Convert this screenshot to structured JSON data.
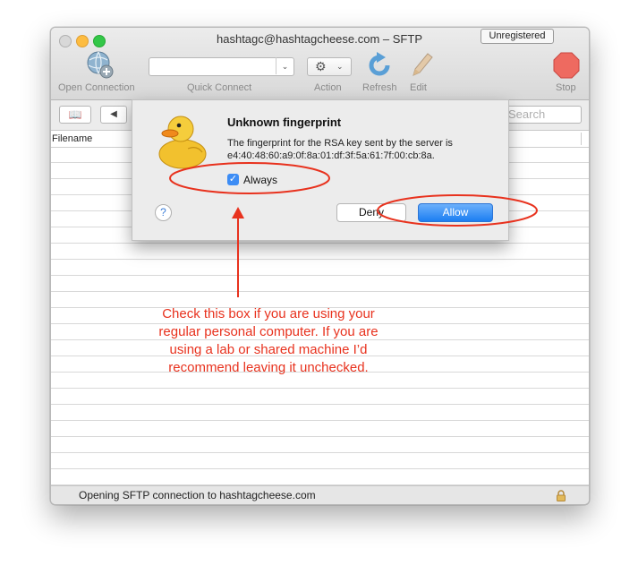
{
  "window": {
    "title": "hashtagc@hashtagcheese.com – SFTP",
    "badge": "Unregistered"
  },
  "toolbar": {
    "open_connection": "Open Connection",
    "quick_connect": "Quick Connect",
    "quick_connect_value": "",
    "action": "Action",
    "refresh": "Refresh",
    "edit": "Edit",
    "stop": "Stop"
  },
  "nav": {
    "search_placeholder": "Search"
  },
  "list": {
    "column_filename": "Filename"
  },
  "status": {
    "text": "Opening SFTP connection to hashtagcheese.com"
  },
  "dialog": {
    "title": "Unknown fingerprint",
    "message_line1": "The fingerprint for the RSA key sent by the server is",
    "message_line2": "e4:40:48:60:a9:0f:8a:01:df:3f:5a:61:7f:00:cb:8a.",
    "checkbox_label": "Always",
    "checkbox_checked": true,
    "deny_label": "Deny",
    "allow_label": "Allow",
    "help_label": "?"
  },
  "annotation": {
    "line1": "Check this box if you are using your",
    "line2": "regular personal computer. If you are",
    "line3": "using a lab or shared machine I’d",
    "line4": "recommend leaving it unchecked.",
    "color": "#e8321e"
  },
  "icons": {
    "accent": "#1c7ef2",
    "stop": "#e8473c"
  }
}
